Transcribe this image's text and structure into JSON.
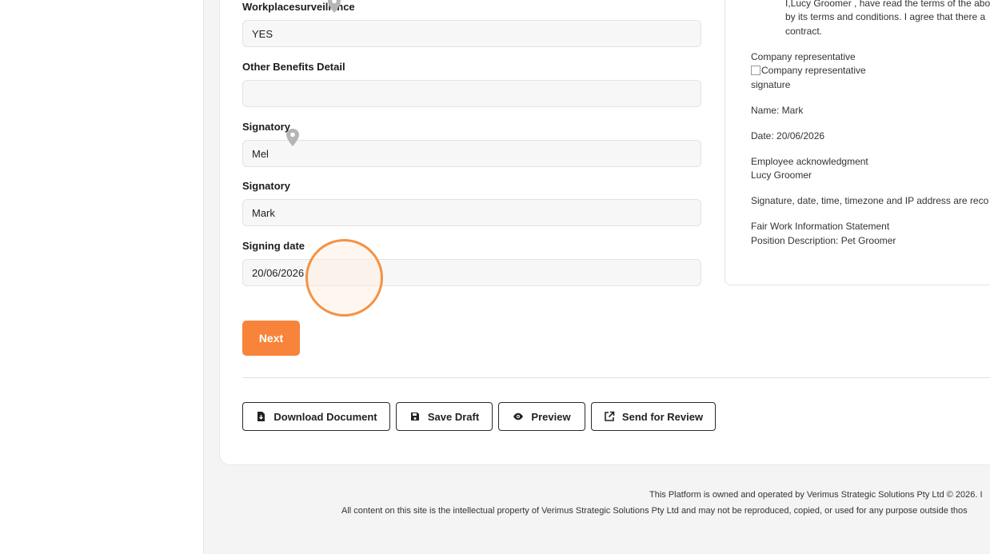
{
  "form": {
    "fields": [
      {
        "label": "Workplacesurveillance",
        "value": "YES"
      },
      {
        "label": "Other Benefits Detail",
        "value": ""
      },
      {
        "label": "Signatory",
        "value": "Mel"
      },
      {
        "label": "Signatory",
        "value": "Mark"
      },
      {
        "label": "Signing date",
        "value": "20/06/2026"
      }
    ],
    "next_label": "Next"
  },
  "actions": {
    "download": "Download Document",
    "save_draft": "Save Draft",
    "preview": "Preview",
    "send_review": "Send for Review"
  },
  "preview": {
    "ack_line1": "I,Lucy Groomer , have read the terms of the abo",
    "ack_line2": "by its terms and conditions. I agree that there a",
    "ack_line3": "contract.",
    "company_rep": "Company representative",
    "signature_alt_line1": "Company representative",
    "signature_alt_line2": "signature",
    "name": "Name: Mark",
    "date": "Date: 20/06/2026",
    "employee_ack": "Employee acknowledgment",
    "employee_name": "Lucy Groomer",
    "signature_note": "Signature, date, time, timezone and IP address are reco",
    "fwis": "Fair Work Information Statement",
    "position_desc": "Position Description: Pet Groomer"
  },
  "footer": {
    "line1": "This Platform is owned and operated by Verimus Strategic Solutions Pty Ltd © 2026. I",
    "line2": "All content on this site is the intellectual property of Verimus Strategic Solutions Pty Ltd and may not be reproduced, copied, or used for any purpose outside thos"
  },
  "colors": {
    "accent": "#f7843a",
    "click_ring": "#f39245"
  }
}
